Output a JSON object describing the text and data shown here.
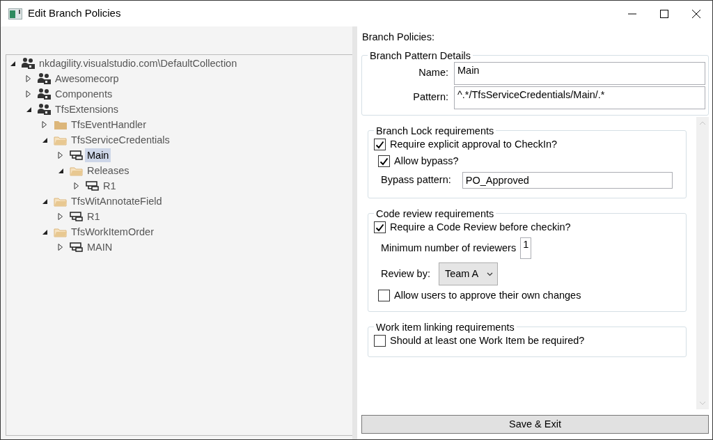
{
  "window": {
    "title": "Edit Branch Policies"
  },
  "tree": [
    {
      "label": "nkdagility.visualstudio.com\\DefaultCollection",
      "kind": "collection",
      "expanded": true,
      "selected": false,
      "children": [
        {
          "label": "Awesomecorp",
          "kind": "collection",
          "expanded": false,
          "selected": false
        },
        {
          "label": "Components",
          "kind": "collection",
          "expanded": false,
          "selected": false
        },
        {
          "label": "TfsExtensions",
          "kind": "collection",
          "expanded": true,
          "selected": false,
          "children": [
            {
              "label": "TfsEventHandler",
              "kind": "folder",
              "expanded": false,
              "selected": false
            },
            {
              "label": "TfsServiceCredentials",
              "kind": "folder",
              "expanded": true,
              "selected": false,
              "children": [
                {
                  "label": "Main",
                  "kind": "branch",
                  "expanded": false,
                  "selected": true
                },
                {
                  "label": "Releases",
                  "kind": "folder",
                  "expanded": true,
                  "selected": false,
                  "children": [
                    {
                      "label": "R1",
                      "kind": "branch",
                      "expanded": false,
                      "selected": false
                    }
                  ]
                }
              ]
            },
            {
              "label": "TfsWitAnnotateField",
              "kind": "folder",
              "expanded": true,
              "selected": false,
              "children": [
                {
                  "label": "R1",
                  "kind": "branch",
                  "expanded": false,
                  "selected": false
                }
              ]
            },
            {
              "label": "TfsWorkItemOrder",
              "kind": "folder",
              "expanded": true,
              "selected": false,
              "children": [
                {
                  "label": "MAIN",
                  "kind": "branch",
                  "expanded": false,
                  "selected": false
                }
              ]
            }
          ]
        }
      ]
    }
  ],
  "policies": {
    "heading": "Branch Policies:",
    "pattern_details": {
      "title": "Branch Pattern Details",
      "fields": [
        {
          "label": "Name:",
          "value": "Main"
        },
        {
          "label": "Pattern:",
          "value": "^.*/TfsServiceCredentials/Main/.*"
        }
      ]
    },
    "groups": [
      {
        "title": "Branch Lock requirements",
        "items": [
          {
            "kind": "checkbox",
            "label": "Require explicit approval to CheckIn?",
            "checked": true
          },
          {
            "kind": "sub_checkbox",
            "label": "Allow bypass?",
            "checked": true
          },
          {
            "kind": "text_field",
            "label": "Bypass pattern:",
            "value": "PO_Approved"
          }
        ]
      },
      {
        "title": "Code review requirements",
        "items": [
          {
            "kind": "checkbox",
            "label": "Require a Code Review before checkin?",
            "checked": true
          },
          {
            "kind": "number_field",
            "label": "Minimum number of reviewers",
            "value": "1"
          },
          {
            "kind": "dropdown",
            "label": "Review by:",
            "value": "Team A"
          },
          {
            "kind": "sub_checkbox",
            "label": "Allow users to approve their own changes",
            "checked": false
          }
        ]
      },
      {
        "title": "Work item linking requirements",
        "items": [
          {
            "kind": "checkbox",
            "label": "Should at least one Work Item be required?",
            "checked": false
          }
        ]
      }
    ]
  },
  "save_button": "Save & Exit"
}
